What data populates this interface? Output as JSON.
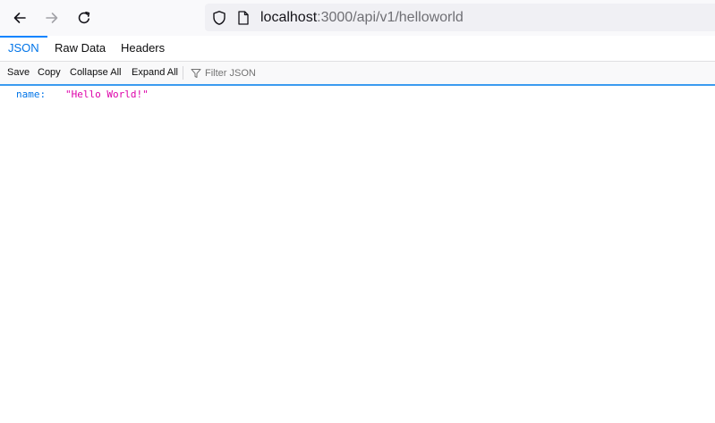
{
  "navigation": {
    "back_icon": "arrow-left-icon",
    "forward_icon": "arrow-right-icon",
    "reload_icon": "reload-icon"
  },
  "urlbar": {
    "host": "localhost",
    "rest": ":3000/api/v1/helloworld",
    "shield_icon": "tracking-protection-shield-icon",
    "page_icon": "page-icon"
  },
  "tabs": [
    {
      "label": "JSON",
      "active": true
    },
    {
      "label": "Raw Data",
      "active": false
    },
    {
      "label": "Headers",
      "active": false
    }
  ],
  "toolbar": {
    "save_label": "Save",
    "copy_label": "Copy",
    "collapse_label": "Collapse All",
    "expand_label": "Expand All",
    "filter_placeholder": "Filter JSON",
    "filter_icon": "filter-icon"
  },
  "json": {
    "rows": [
      {
        "key": "name:",
        "value": "\"Hello World!\""
      }
    ]
  },
  "colors": {
    "accent": "#0a84ff",
    "key": "#0074e8",
    "string": "#dd00a9"
  }
}
